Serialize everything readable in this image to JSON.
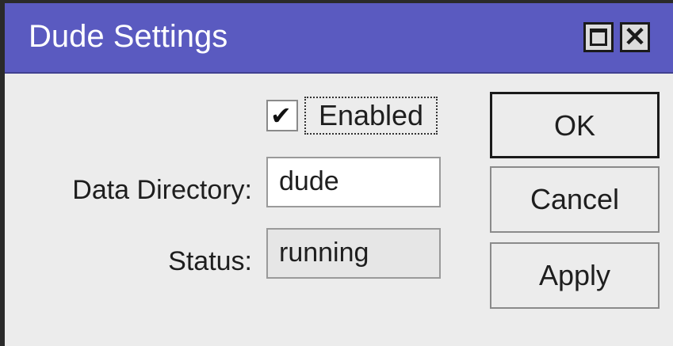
{
  "window": {
    "title": "Dude Settings",
    "maximize_icon": "maximize-icon",
    "close_icon": "close-icon",
    "close_glyph": "✕"
  },
  "form": {
    "enabled": {
      "label": "Enabled",
      "checked": true,
      "check_glyph": "✔"
    },
    "data_directory": {
      "label": "Data Directory:",
      "value": "dude"
    },
    "status": {
      "label": "Status:",
      "value": "running"
    }
  },
  "buttons": {
    "ok": "OK",
    "cancel": "Cancel",
    "apply": "Apply"
  },
  "colors": {
    "titlebar": "#5a5ac0",
    "window_bg": "#ececec"
  }
}
